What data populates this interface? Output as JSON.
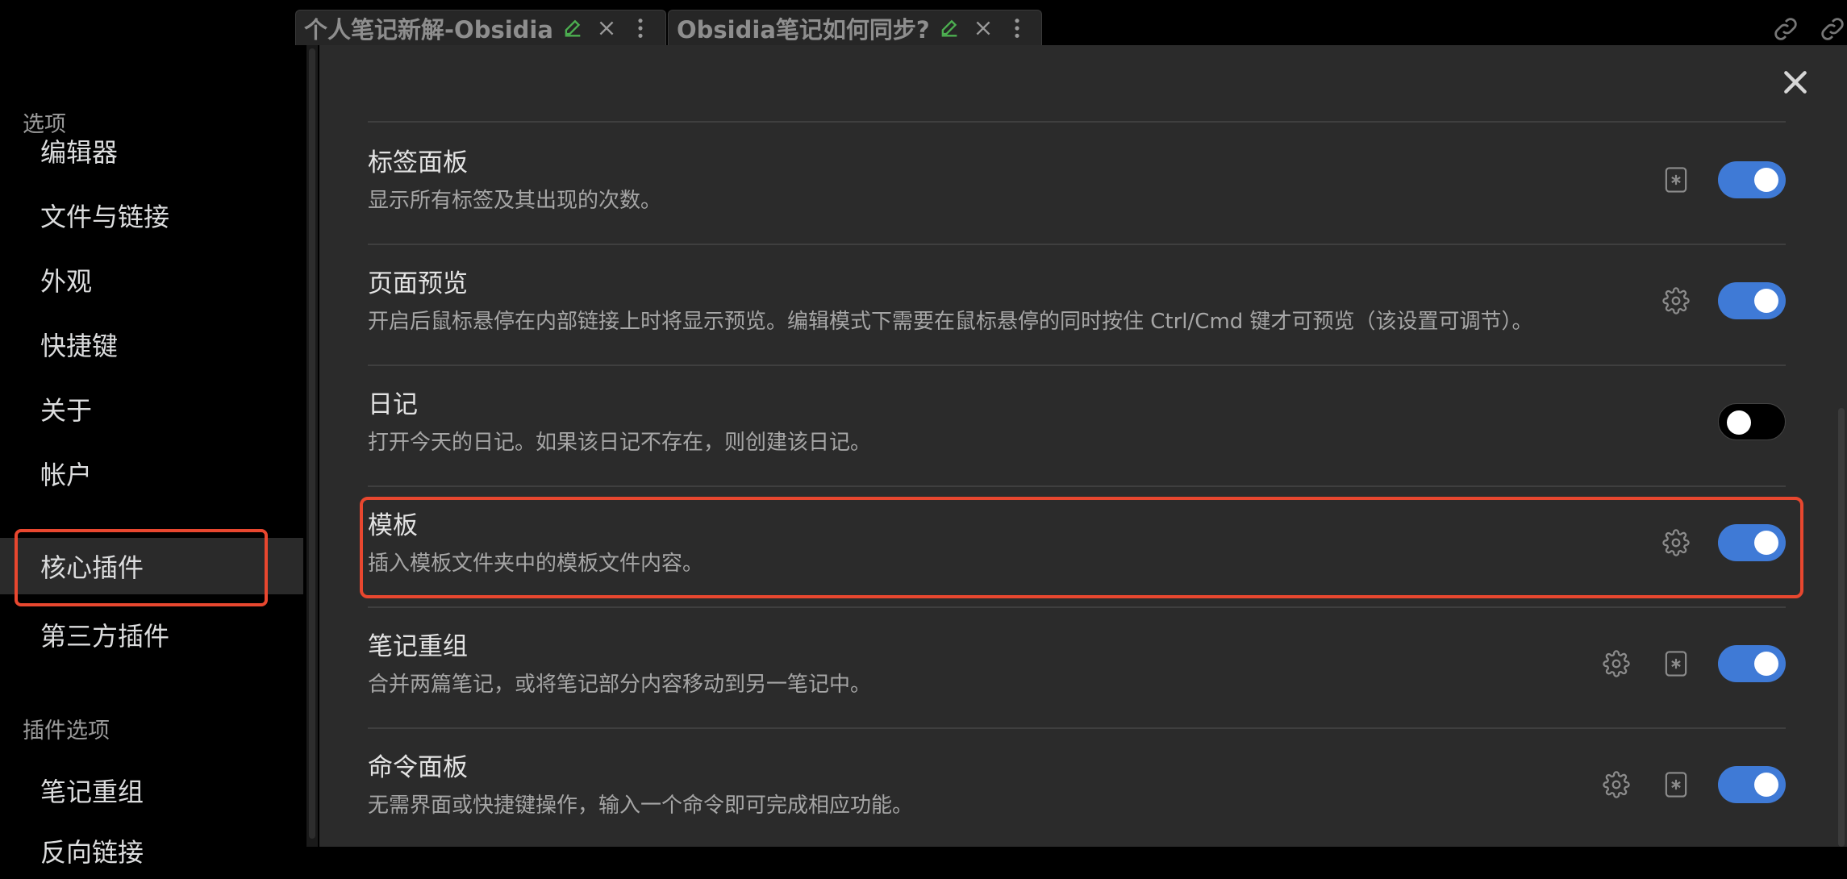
{
  "tabs": [
    {
      "title": "个人笔记新解-Obsidia"
    },
    {
      "title": "Obsidia笔记如何同步?"
    }
  ],
  "sidebar": {
    "section_options": "选项",
    "items": [
      {
        "label": "编辑器"
      },
      {
        "label": "文件与链接"
      },
      {
        "label": "外观"
      },
      {
        "label": "快捷键"
      },
      {
        "label": "关于"
      },
      {
        "label": "帐户"
      },
      {
        "label": "核心插件",
        "active": true
      },
      {
        "label": "第三方插件"
      }
    ],
    "section_plugin_options": "插件选项",
    "plugin_items": [
      {
        "label": "笔记重组"
      },
      {
        "label": "反向链接"
      }
    ]
  },
  "plugins": [
    {
      "title": "标签面板",
      "desc": "显示所有标签及其出现的次数。",
      "enabled": true,
      "icons": [
        "hotkey-icon"
      ]
    },
    {
      "title": "页面预览",
      "desc": "开启后鼠标悬停在内部链接上时将显示预览。编辑模式下需要在鼠标悬停的同时按住 Ctrl/Cmd 键才可预览（该设置可调节）。",
      "enabled": true,
      "icons": [
        "gear-icon"
      ]
    },
    {
      "title": "日记",
      "desc": "打开今天的日记。如果该日记不存在，则创建该日记。",
      "enabled": false,
      "icons": []
    },
    {
      "title": "模板",
      "desc": "插入模板文件夹中的模板文件内容。",
      "enabled": true,
      "icons": [
        "gear-icon"
      ],
      "highlighted": true
    },
    {
      "title": "笔记重组",
      "desc": "合并两篇笔记，或将笔记部分内容移动到另一笔记中。",
      "enabled": true,
      "icons": [
        "gear-icon",
        "hotkey-icon"
      ]
    },
    {
      "title": "命令面板",
      "desc": "无需界面或快捷键操作，输入一个命令即可完成相应功能。",
      "enabled": true,
      "icons": [
        "gear-icon",
        "hotkey-icon"
      ]
    }
  ],
  "colors": {
    "accent": "#3f7ad6",
    "highlight": "#e8472f",
    "edit_icon": "#4caf50"
  }
}
